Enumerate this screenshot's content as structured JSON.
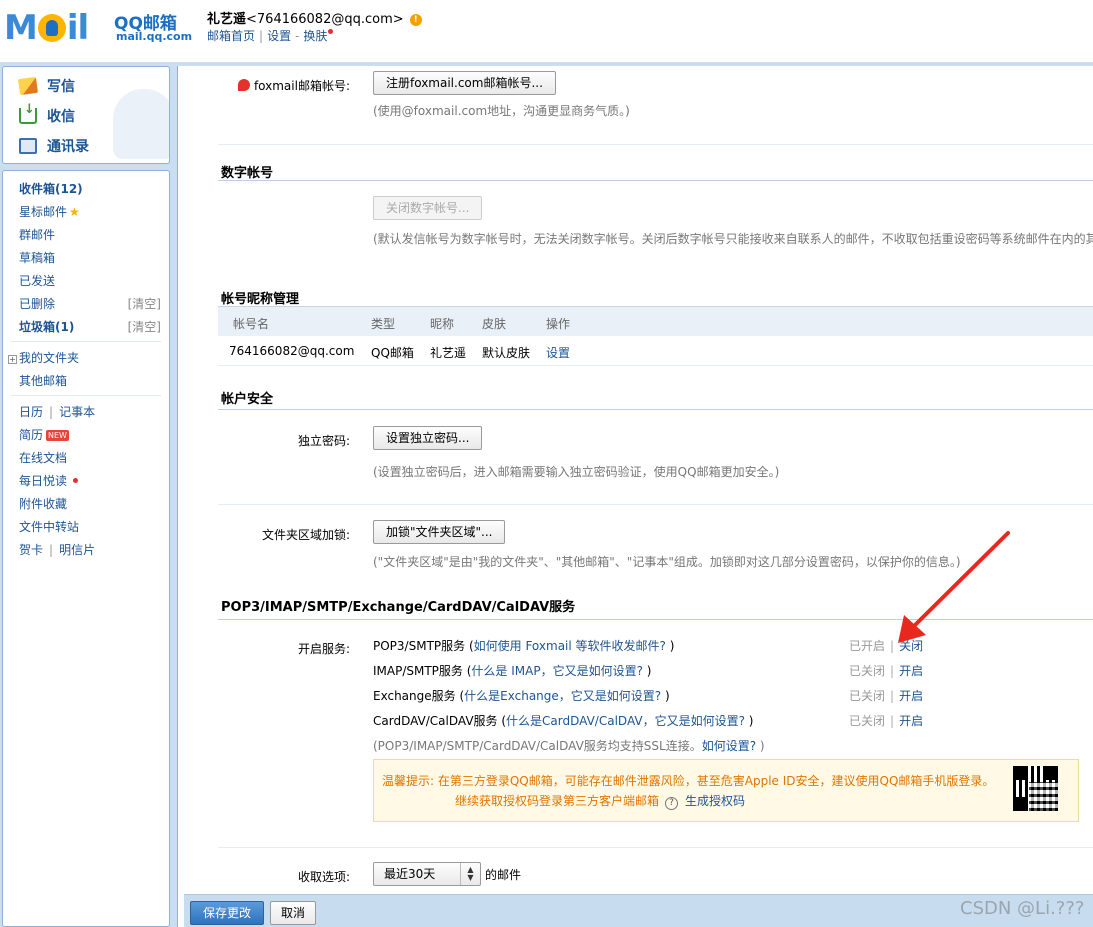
{
  "header": {
    "logo_mail": "M",
    "logo_mail_rest": "il",
    "logo_qq": "QQ邮箱",
    "logo_domain": "mail.qq.com",
    "user_name": "礼艺遥",
    "user_email": "<764166082@qq.com>",
    "warn_glyph": "!",
    "link_home": "邮箱首页",
    "sep": "|",
    "link_settings": "设置",
    "dash": "-",
    "link_skin": "换肤"
  },
  "actions": {
    "write": "写信",
    "receive": "收信",
    "contacts": "通讯录"
  },
  "nav": {
    "inbox": "收件箱(12)",
    "starred": "星标邮件",
    "star_glyph": "★",
    "group": "群邮件",
    "drafts": "草稿箱",
    "sent": "已发送",
    "deleted": "已删除",
    "clear": "[清空]",
    "spam": "垃圾箱(1)",
    "my_folders": "我的文件夹",
    "plus_glyph": "+",
    "other_mail": "其他邮箱",
    "calendar": "日历",
    "sep": "|",
    "notes": "记事本",
    "resume": "简历",
    "new_badge": "NEW",
    "online_docs": "在线文档",
    "daily_read": "每日悦读",
    "attachments": "附件收藏",
    "transfer": "文件中转站",
    "cards": "贺卡",
    "postcards": "明信片"
  },
  "foxmail": {
    "label": "foxmail邮箱帐号:",
    "button": "注册foxmail.com邮箱帐号...",
    "hint": "(使用@foxmail.com地址，沟通更显商务气质。)"
  },
  "digital": {
    "title": "数字帐号",
    "button": "关闭数字帐号...",
    "hint": "(默认发信帐号为数字帐号时，无法关闭数字帐号。关闭后数字帐号只能接收来自联系人的邮件，不收取包括重设密码等系统邮件在内的其"
  },
  "nickname": {
    "title": "帐号昵称管理",
    "columns": [
      "帐号名",
      "类型",
      "昵称",
      "皮肤",
      "操作"
    ],
    "row": [
      "764166082@qq.com",
      "QQ邮箱",
      "礼艺遥",
      "默认皮肤",
      "设置"
    ]
  },
  "security": {
    "title": "帐户安全",
    "pwd_label": "独立密码:",
    "pwd_button": "设置独立密码...",
    "pwd_hint": "(设置独立密码后，进入邮箱需要输入独立密码验证，使用QQ邮箱更加安全。)",
    "lock_label": "文件夹区域加锁:",
    "lock_button": "加锁\"文件夹区域\"...",
    "lock_hint": "(\"文件夹区域\"是由\"我的文件夹\"、\"其他邮箱\"、\"记事本\"组成。加锁即对这几部分设置密码，以保护你的信息。)"
  },
  "services": {
    "title": "POP3/IMAP/SMTP/Exchange/CardDAV/CalDAV服务",
    "label": "开启服务:",
    "sep": "|",
    "rows": [
      {
        "name": "POP3/SMTP服务 (",
        "question": "如何使用 Foxmail 等软件收发邮件?",
        "close": " )",
        "state": "已开启",
        "action": "关闭"
      },
      {
        "name": "IMAP/SMTP服务 (",
        "question": "什么是 IMAP，它又是如何设置?",
        "close": " )",
        "state": "已关闭",
        "action": "开启"
      },
      {
        "name": "Exchange服务 (",
        "question": "什么是Exchange，它又是如何设置?",
        "close": " )",
        "state": "已关闭",
        "action": "开启"
      },
      {
        "name": "CardDAV/CalDAV服务 (",
        "question": "什么是CardDAV/CalDAV，它又是如何设置?",
        "close": " )",
        "state": "已关闭",
        "action": "开启"
      }
    ],
    "ssl_hint": "(POP3/IMAP/SMTP/CardDAV/CalDAV服务均支持SSL连接。",
    "ssl_link": "如何设置?",
    "ssl_close": " )",
    "tip_line1": "温馨提示: 在第三方登录QQ邮箱，可能存在邮件泄露风险，甚至危害Apple ID安全，建议使用QQ邮箱手机版登录。",
    "tip_line2": "继续获取授权码登录第三方客户端邮箱",
    "help_glyph": "?",
    "generate_link": "生成授权码"
  },
  "receive": {
    "label": "收取选项:",
    "selected": "最近30天",
    "suffix": "的邮件"
  },
  "footer": {
    "save": "保存更改",
    "cancel": "取消",
    "watermark": "CSDN @Li.???"
  }
}
